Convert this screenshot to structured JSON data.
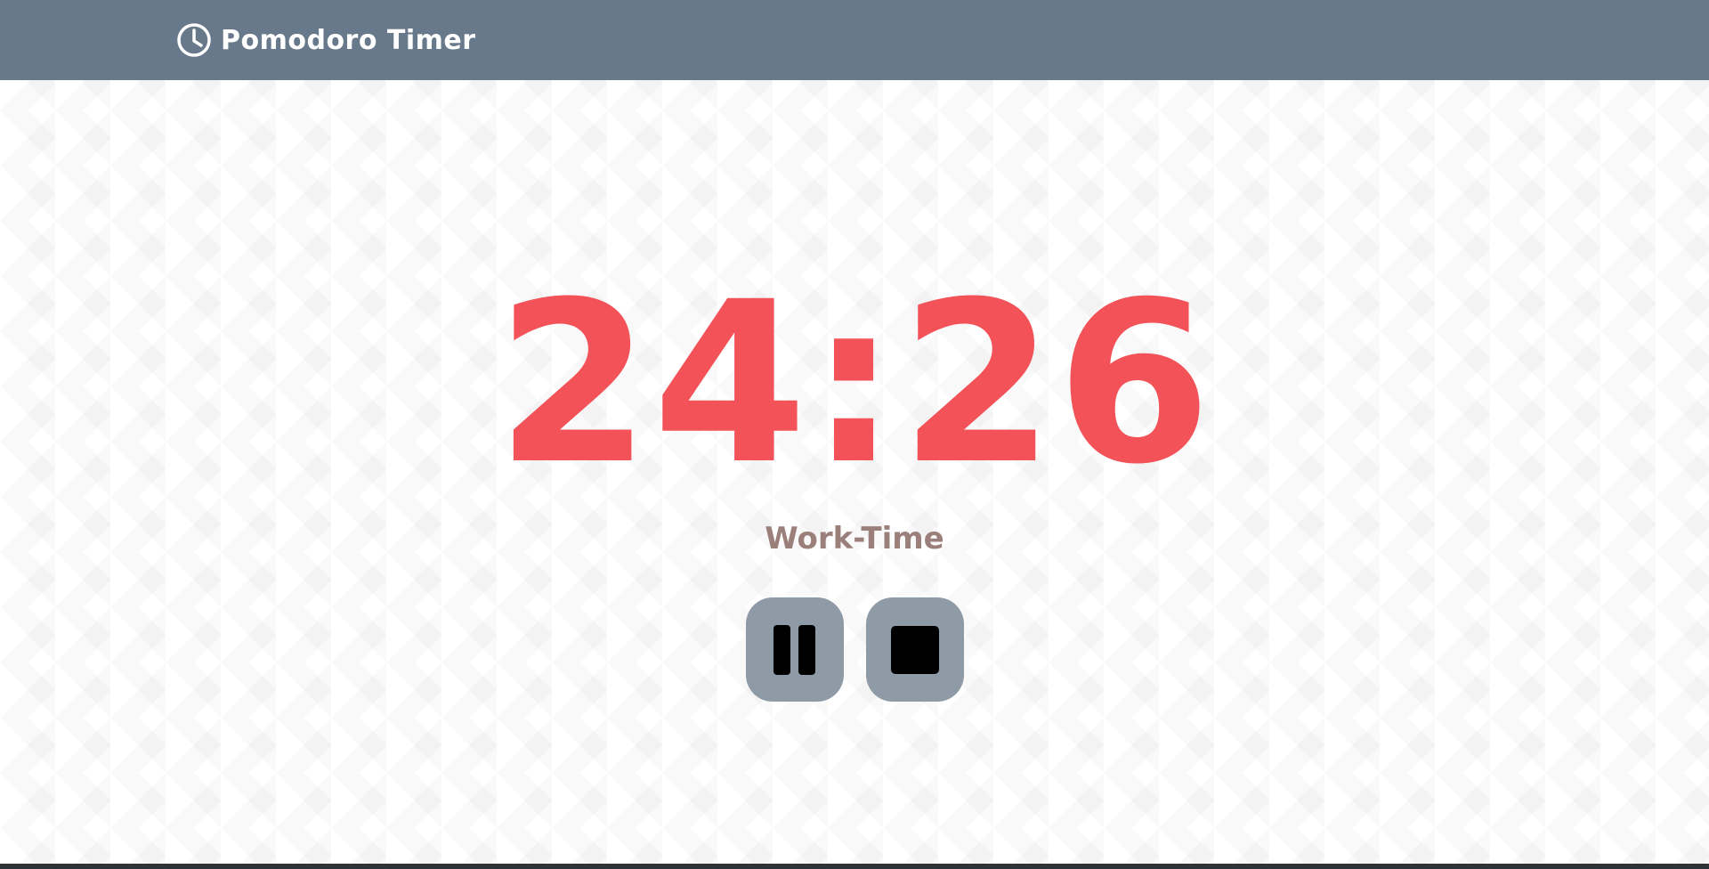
{
  "header": {
    "title": "Pomodoro Timer",
    "icon": "clock-icon",
    "background_color": "#67798a"
  },
  "timer": {
    "display": "24:26",
    "color": "#f25258"
  },
  "mode": {
    "label": "Work-Time",
    "color": "#9b7f7b"
  },
  "controls": {
    "pause": {
      "icon": "pause-icon"
    },
    "stop": {
      "icon": "stop-icon"
    },
    "button_color": "#8e9aa6"
  }
}
